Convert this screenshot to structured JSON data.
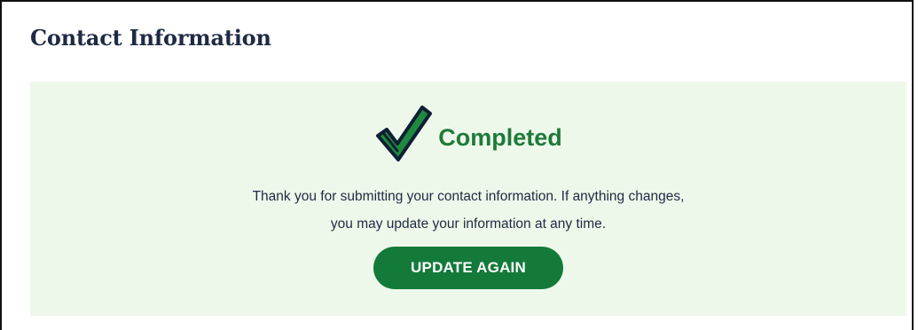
{
  "section": {
    "title": "Contact Information"
  },
  "status": {
    "icon": "checkmark-icon",
    "label": "Completed",
    "color": "#1e7a3a"
  },
  "message": {
    "line1": "Thank you for submitting your contact information.  If anything changes,",
    "line2": "you may update your information at any time."
  },
  "actions": {
    "update_label": "UPDATE AGAIN",
    "button_color": "#137a3a"
  },
  "colors": {
    "panel_background": "#eef8ea",
    "title_text": "#1f2a44"
  }
}
